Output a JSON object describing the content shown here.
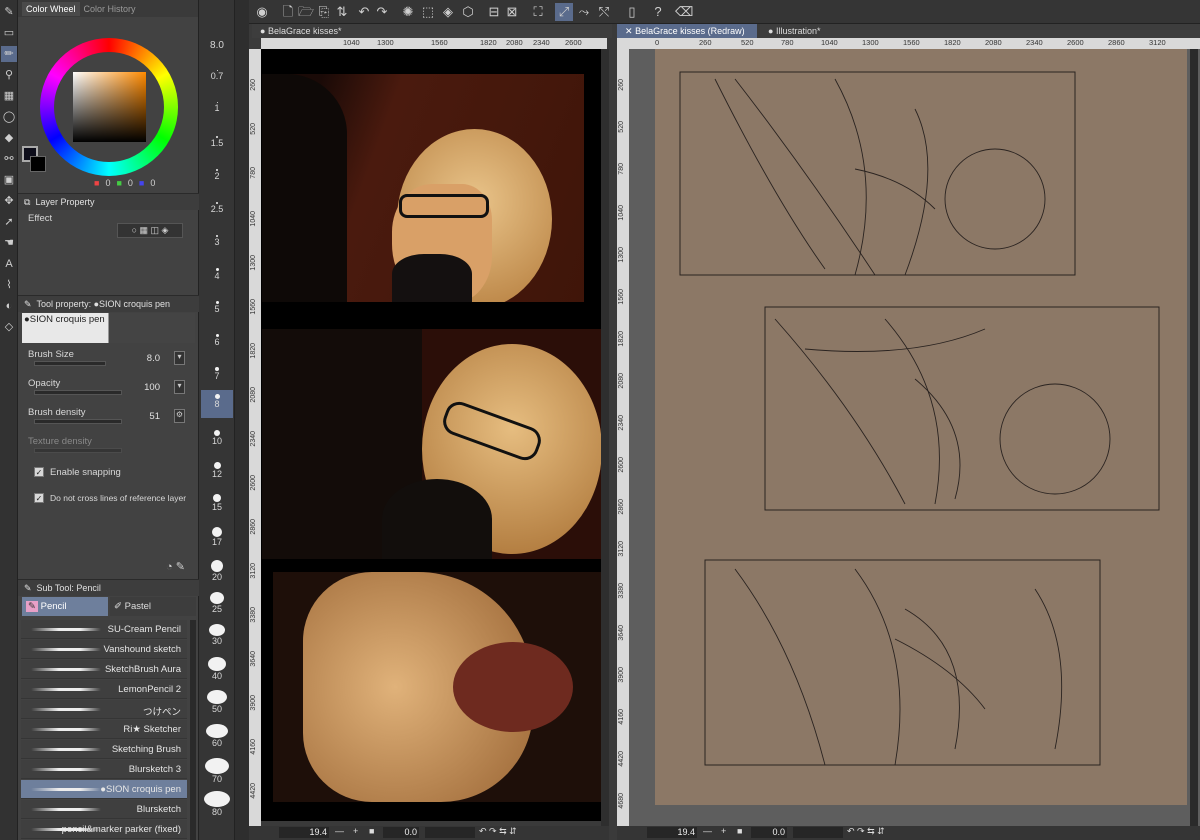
{
  "toolbar": {
    "icons": [
      "pen-icon",
      "select-rect-icon",
      "pencil-icon",
      "dropper-icon",
      "eraser-icon",
      "lasso-icon",
      "fill-icon",
      "zoom-icon",
      "move-icon",
      "operation-icon",
      "text-icon",
      "frame-icon",
      "gradient-icon",
      "figure-icon",
      "blend-icon",
      "hand-icon"
    ]
  },
  "color_panel": {
    "tab_active": "Color Wheel",
    "tab_inactive": "Color History",
    "r": "0",
    "g": "0",
    "b": "0"
  },
  "layer_property": {
    "title": "Layer Property",
    "effect_label": "Effect"
  },
  "tool_property": {
    "title": "Tool property: ●SION croquis pen",
    "brush_name": "●SION croquis pen",
    "brush_size_label": "Brush Size",
    "brush_size_value": "8.0",
    "opacity_label": "Opacity",
    "opacity_value": "100",
    "brush_density_label": "Brush density",
    "brush_density_value": "51",
    "texture_density_label": "Texture density",
    "enable_snapping_label": "Enable snapping",
    "no_cross_label": "Do not cross lines of reference layer"
  },
  "subtool": {
    "title": "Sub Tool: Pencil",
    "tab_pencil": "Pencil",
    "tab_pastel": "Pastel",
    "brushes": [
      "SU-Cream Pencil",
      "Vanshound sketch",
      "SketchBrush Aura",
      "LemonPencil 2",
      "つけペン",
      "Ri★ Sketcher",
      "Sketching Brush",
      "Blursketch 3",
      "●SION croquis pen",
      "Blursketch",
      "pencil&marker  parker  (fixed)"
    ],
    "selected_index": 8
  },
  "brush_sizes": {
    "current": "8.0",
    "list": [
      "0.7",
      "1",
      "1.5",
      "2",
      "2.5",
      "3",
      "4",
      "5",
      "6",
      "7",
      "8",
      "10",
      "12",
      "15",
      "17",
      "20",
      "25",
      "30",
      "40",
      "50",
      "60",
      "70",
      "80"
    ],
    "selected": "8"
  },
  "canvas_left": {
    "tab_title": "BelaGrace kisses*",
    "ruler_top": [
      "1040",
      "1300",
      "1560",
      "1820",
      "2080",
      "2340",
      "2600"
    ],
    "ruler_left": [
      "260",
      "520",
      "780",
      "1040",
      "1300",
      "1560",
      "1820",
      "2080",
      "2340",
      "2600",
      "2860",
      "3120",
      "3380",
      "3640",
      "3900",
      "4160",
      "4420"
    ],
    "zoom": "19.4",
    "angle": "0.0"
  },
  "canvas_right": {
    "tab_title": "BelaGrace kisses (Redraw)",
    "tab2_title": "Illustration*",
    "ruler_top": [
      "0",
      "260",
      "520",
      "780",
      "1040",
      "1300",
      "1560",
      "1820",
      "2080",
      "2340",
      "2600",
      "2860",
      "3120"
    ],
    "ruler_left": [
      "260",
      "520",
      "780",
      "1040",
      "1300",
      "1560",
      "1820",
      "2080",
      "2340",
      "2600",
      "2860",
      "3120",
      "3380",
      "3640",
      "3900",
      "4160",
      "4420",
      "4680"
    ],
    "zoom": "19.4",
    "angle": "0.0"
  },
  "colors": {
    "panel": "#424242",
    "canvas_bg": "#8c7866",
    "selection": "#6e7f9c"
  }
}
